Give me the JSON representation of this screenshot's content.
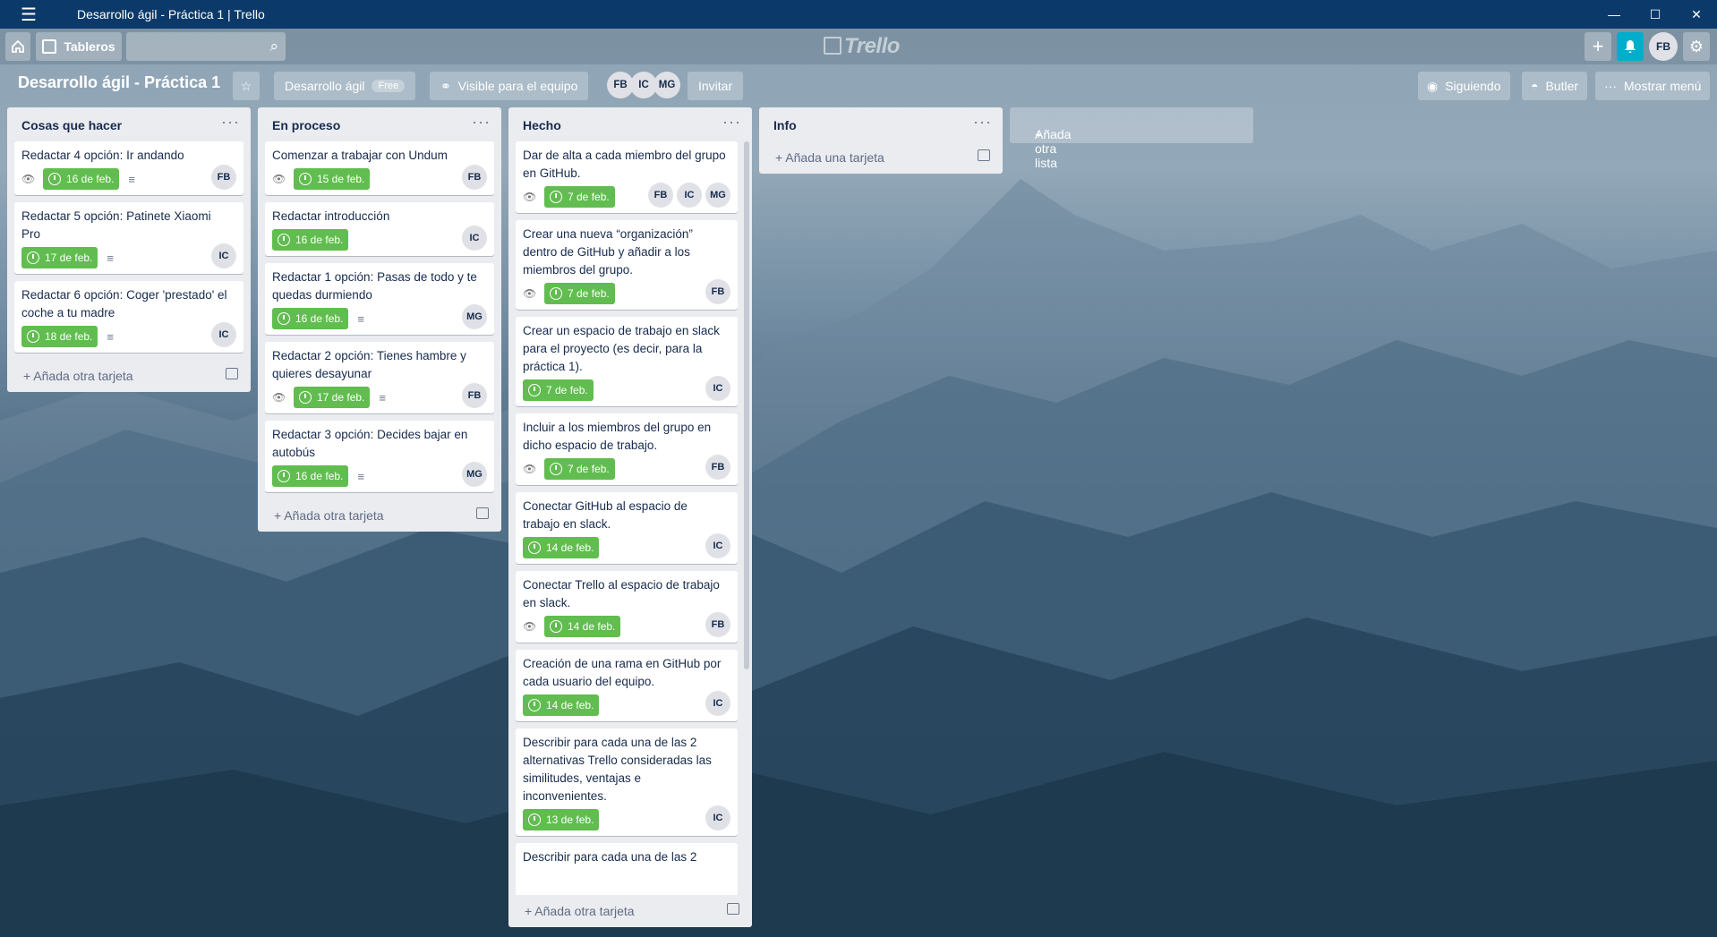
{
  "window": {
    "title": "Desarrollo ágil - Práctica 1 | Trello",
    "controls": [
      "minimize",
      "maximize",
      "close"
    ]
  },
  "topbar": {
    "home_icon": "home-icon",
    "boards_label": "Tableros",
    "search_placeholder": "",
    "logo": "Trello",
    "user_initials": "FB"
  },
  "board": {
    "title": "Desarrollo ágil - Práctica 1",
    "team_label": "Desarrollo ágil",
    "plan_badge": "Free",
    "visibility_label": "Visible para el equipo",
    "members": [
      "FB",
      "IC",
      "MG"
    ],
    "invite_label": "Invitar",
    "following_label": "Siguiendo",
    "butler_label": "Butler",
    "menu_label": "Mostrar menú"
  },
  "lists": [
    {
      "title": "Cosas que hacer",
      "add_label": "Añada otra tarjeta",
      "cards": [
        {
          "title": "Redactar 4 opción: Ir andando",
          "watch": true,
          "due": "16 de feb.",
          "desc": true,
          "members": [
            "FB"
          ]
        },
        {
          "title": "Redactar 5 opción: Patinete Xiaomi Pro",
          "watch": false,
          "due": "17 de feb.",
          "desc": true,
          "members": [
            "IC"
          ]
        },
        {
          "title": "Redactar 6 opción: Coger 'prestado' el coche a tu madre",
          "watch": false,
          "due": "18 de feb.",
          "desc": true,
          "members": [
            "IC"
          ]
        }
      ]
    },
    {
      "title": "En proceso",
      "add_label": "Añada otra tarjeta",
      "cards": [
        {
          "title": "Comenzar a trabajar con Undum",
          "watch": true,
          "due": "15 de feb.",
          "desc": false,
          "members": [
            "FB"
          ]
        },
        {
          "title": "Redactar introducción",
          "watch": false,
          "due": "16 de feb.",
          "desc": false,
          "members": [
            "IC"
          ]
        },
        {
          "title": "Redactar 1 opción: Pasas de todo y te quedas durmiendo",
          "watch": false,
          "due": "16 de feb.",
          "desc": true,
          "members": [
            "MG"
          ]
        },
        {
          "title": "Redactar 2 opción: Tienes hambre y quieres desayunar",
          "watch": true,
          "due": "17 de feb.",
          "desc": true,
          "members": [
            "FB"
          ]
        },
        {
          "title": "Redactar 3 opción: Decides bajar en autobús",
          "watch": false,
          "due": "16 de feb.",
          "desc": true,
          "members": [
            "MG"
          ]
        }
      ]
    },
    {
      "title": "Hecho",
      "add_label": "Añada otra tarjeta",
      "cards": [
        {
          "title": "Dar de alta a cada miembro del grupo en GitHub.",
          "watch": true,
          "due": "7 de feb.",
          "desc": false,
          "members": [
            "FB",
            "IC",
            "MG"
          ]
        },
        {
          "title": "Crear una nueva “organización” dentro de GitHub y añadir a los miembros del grupo.",
          "watch": true,
          "due": "7 de feb.",
          "desc": false,
          "members": [
            "FB"
          ]
        },
        {
          "title": "Crear un espacio de trabajo en slack para el proyecto (es decir, para la práctica 1).",
          "watch": false,
          "due": "7 de feb.",
          "desc": false,
          "members": [
            "IC"
          ]
        },
        {
          "title": "Incluir a los miembros del grupo en dicho espacio de trabajo.",
          "watch": true,
          "due": "7 de feb.",
          "desc": false,
          "members": [
            "FB"
          ]
        },
        {
          "title": "Conectar GitHub al espacio de trabajo en slack.",
          "watch": false,
          "due": "14 de feb.",
          "desc": false,
          "members": [
            "IC"
          ]
        },
        {
          "title": "Conectar Trello al espacio de trabajo en slack.",
          "watch": true,
          "due": "14 de feb.",
          "desc": false,
          "members": [
            "FB"
          ]
        },
        {
          "title": "Creación de una rama en GitHub por cada usuario del equipo.",
          "watch": false,
          "due": "14 de feb.",
          "desc": false,
          "members": [
            "IC"
          ]
        },
        {
          "title": "Describir para cada una de las 2 alternativas Trello consideradas las similitudes, ventajas e inconvenientes.",
          "watch": false,
          "due": "13 de feb.",
          "desc": false,
          "members": [
            "IC"
          ]
        },
        {
          "title": "Describir para cada una de las 2",
          "watch": false,
          "due": "",
          "desc": false,
          "members": []
        }
      ]
    },
    {
      "title": "Info",
      "add_label": "Añada una tarjeta",
      "cards": []
    }
  ],
  "add_list_label": "Añada otra lista"
}
